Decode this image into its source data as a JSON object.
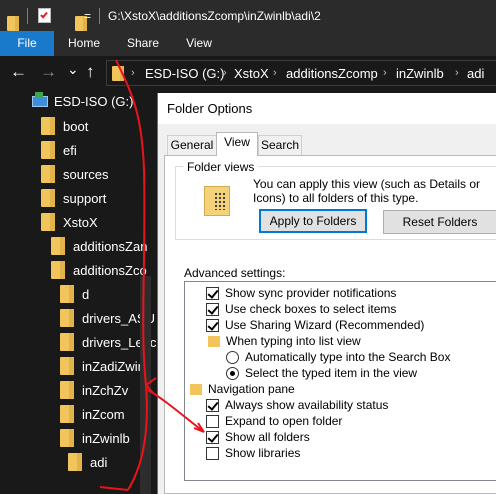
{
  "window": {
    "title_path": "G:\\XstoX\\additionsZcomp\\inZwinlb\\adi\\2",
    "quick_access_dropdown": "="
  },
  "ribbon": {
    "tabs": [
      "File",
      "Home",
      "Share",
      "View"
    ]
  },
  "nav": {
    "back": "←",
    "forward": "→",
    "recent": "⌄",
    "up": "↑",
    "separator": "›",
    "breadcrumbs": [
      "ESD-ISO (G:)",
      "XstoX",
      "additionsZcomp",
      "inZwinlb",
      "adi"
    ]
  },
  "tree": {
    "drive": "ESD-ISO (G:)",
    "items": [
      "boot",
      "efi",
      "sources",
      "support",
      "XstoX",
      "additionsZan",
      "additionsZco",
      "d",
      "drivers_ASU",
      "drivers_Lenc",
      "inZadiZwinl",
      "inZchZv",
      "inZcom",
      "inZwinlb",
      "adi"
    ]
  },
  "dialog": {
    "title": "Folder Options",
    "tabs": [
      "General",
      "View",
      "Search"
    ],
    "active_tab": "View",
    "folder_views": {
      "heading": "Folder views",
      "description": "You can apply this view (such as Details or Icons) to all folders of this type.",
      "apply_button": "Apply to Folders",
      "reset_button": "Reset Folders"
    },
    "advanced": {
      "heading": "Advanced settings:",
      "items": [
        {
          "type": "checkbox",
          "label": "Show sync provider notifications",
          "checked": true
        },
        {
          "type": "checkbox",
          "label": "Use check boxes to select items",
          "checked": true
        },
        {
          "type": "checkbox",
          "label": "Use Sharing Wizard (Recommended)",
          "checked": true
        },
        {
          "type": "folder",
          "label": "When typing into list view"
        },
        {
          "type": "radio",
          "label": "Automatically type into the Search Box",
          "checked": false
        },
        {
          "type": "radio",
          "label": "Select the typed item in the view",
          "checked": true
        },
        {
          "type": "folder",
          "label": "Navigation pane"
        },
        {
          "type": "checkbox",
          "label": "Always show availability status",
          "checked": true
        },
        {
          "type": "checkbox",
          "label": "Expand to open folder",
          "checked": false
        },
        {
          "type": "checkbox",
          "label": "Show all folders",
          "checked": true
        },
        {
          "type": "checkbox",
          "label": "Show libraries",
          "checked": false
        }
      ]
    }
  },
  "colors": {
    "accent": "#1979ca",
    "annotation": "#e8141b",
    "folder": "#f2c55c",
    "dark_bg": "#191919"
  }
}
